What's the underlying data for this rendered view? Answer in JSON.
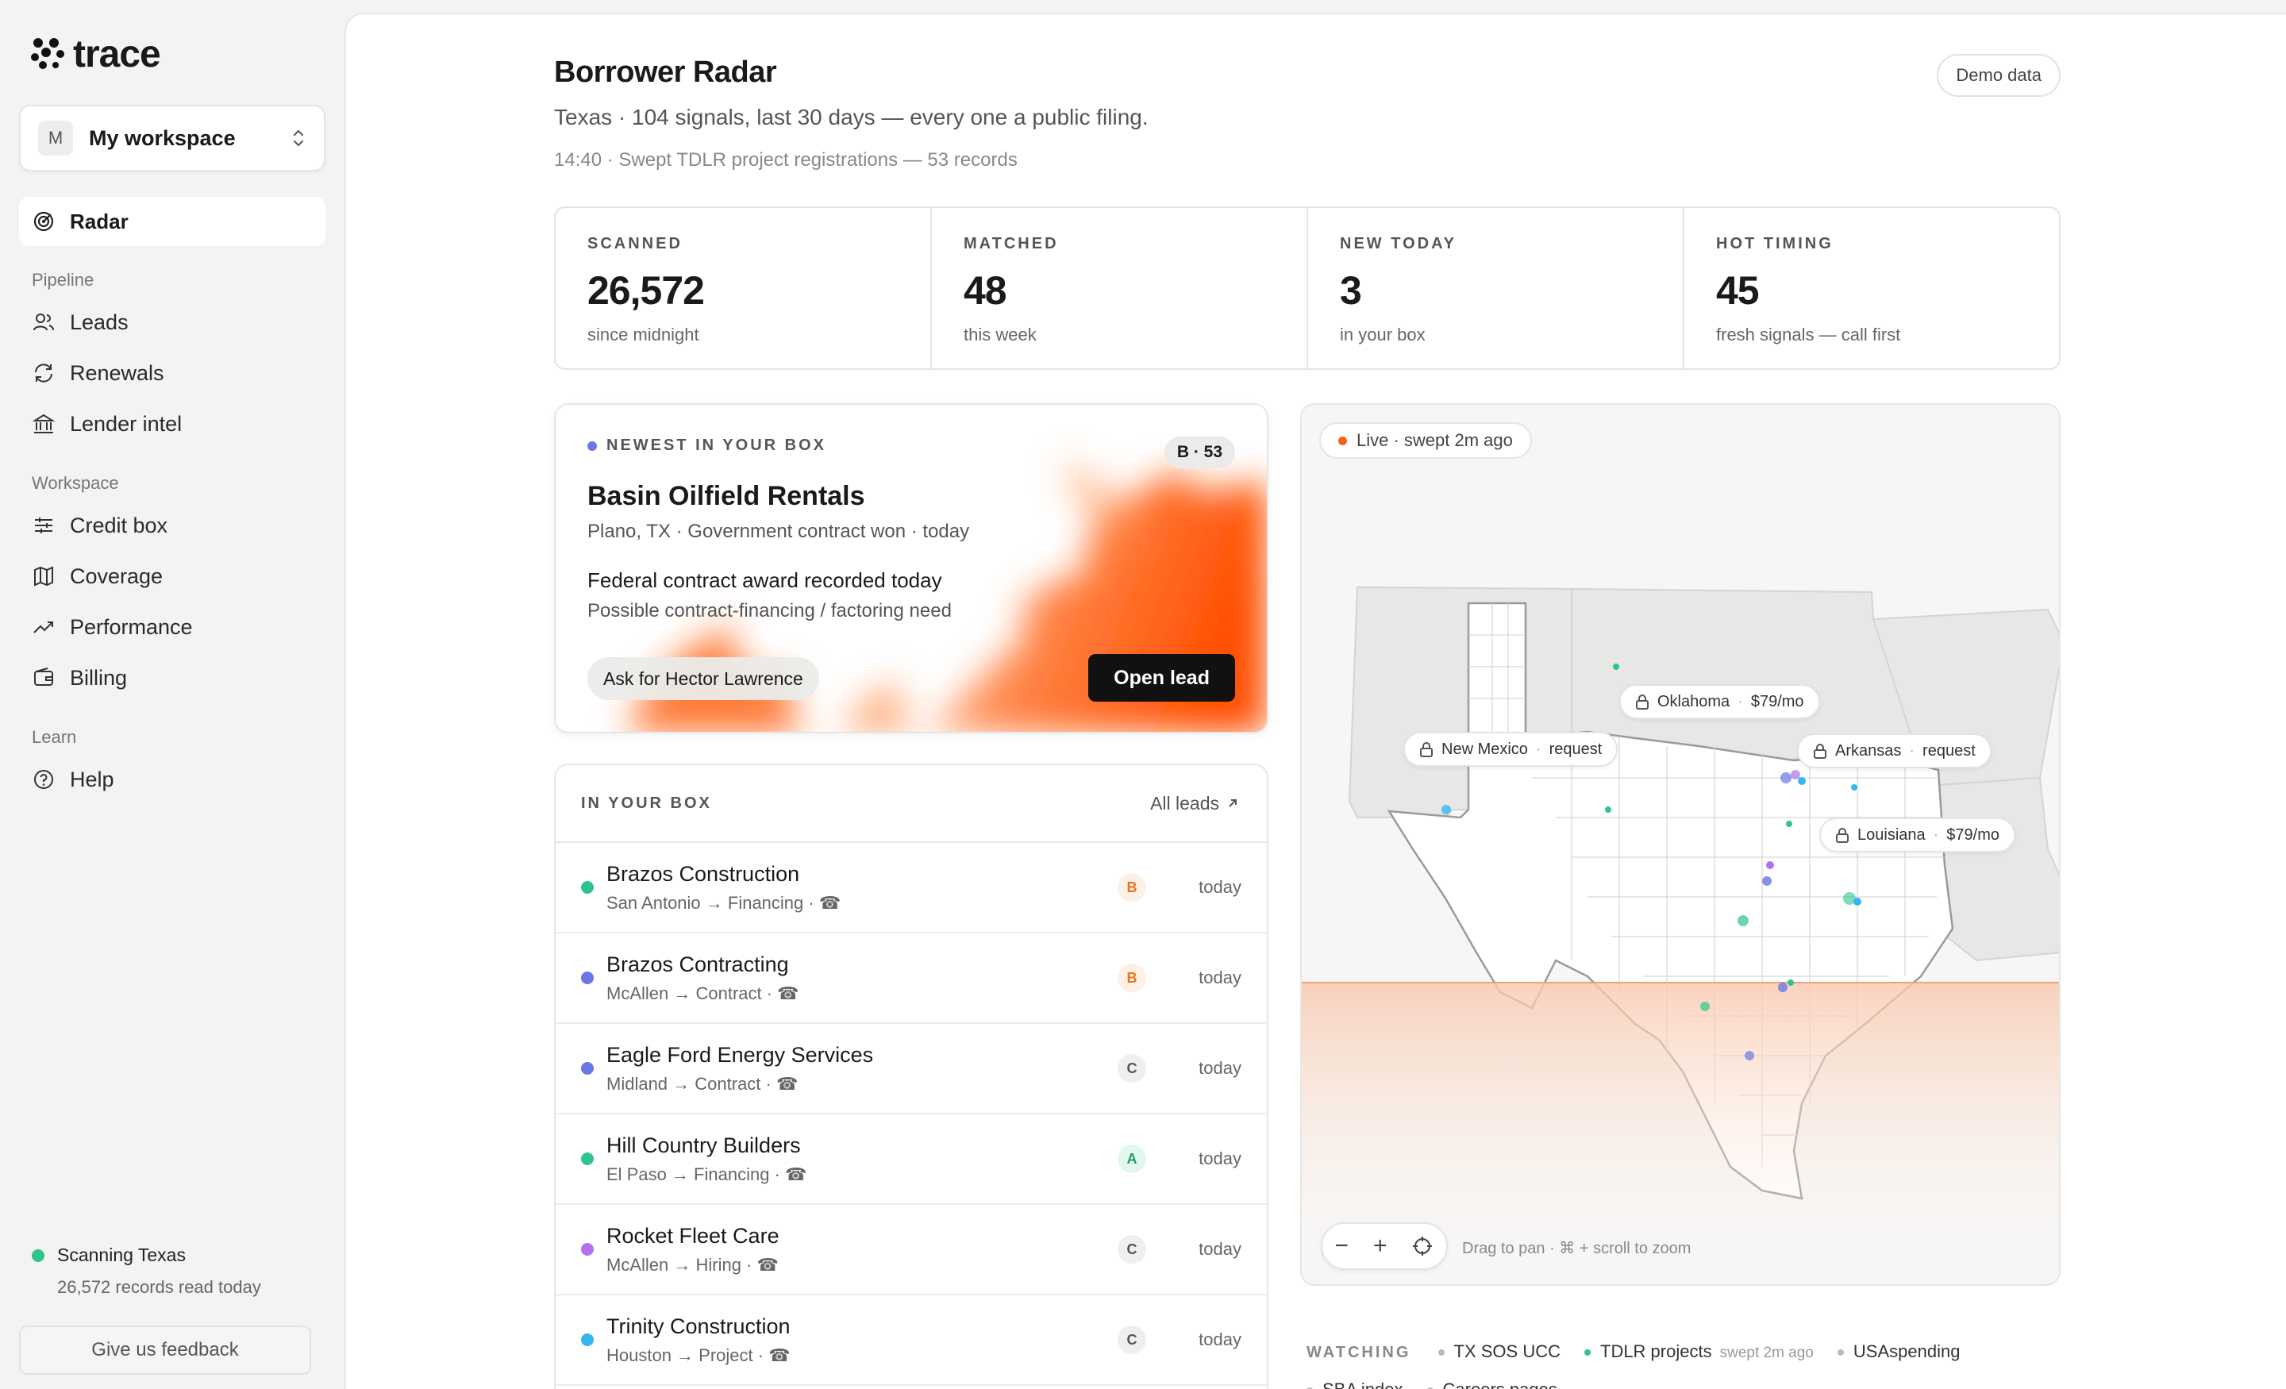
{
  "brand": {
    "name": "trace"
  },
  "workspace": {
    "initial": "M",
    "name": "My workspace"
  },
  "nav": {
    "active": "Radar",
    "groups": [
      {
        "label": "Pipeline",
        "items": [
          "Leads",
          "Renewals",
          "Lender intel"
        ]
      },
      {
        "label": "Workspace",
        "items": [
          "Credit box",
          "Coverage",
          "Performance",
          "Billing"
        ]
      },
      {
        "label": "Learn",
        "items": [
          "Help"
        ]
      }
    ]
  },
  "status": {
    "title": "Scanning Texas",
    "sub": "26,572 records read today"
  },
  "feedback_label": "Give us feedback",
  "page": {
    "title": "Borrower Radar",
    "subtitle": "Texas · 104 signals, last 30 days — every one a public filing.",
    "meta": "14:40 · Swept TDLR project registrations — 53 records",
    "demo_label": "Demo data"
  },
  "stats": [
    {
      "label": "SCANNED",
      "value": "26,572",
      "sub": "since midnight"
    },
    {
      "label": "MATCHED",
      "value": "48",
      "sub": "this week"
    },
    {
      "label": "NEW TODAY",
      "value": "3",
      "sub": "in your box"
    },
    {
      "label": "HOT TIMING",
      "value": "45",
      "sub": "fresh signals — call first"
    }
  ],
  "newest": {
    "label": "NEWEST IN YOUR BOX",
    "score": "B · 53",
    "name": "Basin Oilfield Rentals",
    "location": "Plano, TX · Government contract won · today",
    "headline": "Federal contract award recorded today",
    "need": "Possible contract-financing / factoring need",
    "ask": "Ask for Hector Lawrence",
    "open_label": "Open lead"
  },
  "inbox": {
    "title": "IN YOUR BOX",
    "all_label": "All leads",
    "rows": [
      {
        "name": "Brazos Construction",
        "sub": "San Antonio → Financing · ☎",
        "grade": "B",
        "when": "today",
        "dot": "#2fc48d"
      },
      {
        "name": "Brazos Contracting",
        "sub": "McAllen → Contract · ☎",
        "grade": "B",
        "when": "today",
        "dot": "#6b77e5"
      },
      {
        "name": "Eagle Ford Energy Services",
        "sub": "Midland → Contract · ☎",
        "grade": "C",
        "when": "today",
        "dot": "#6b77e5"
      },
      {
        "name": "Hill Country Builders",
        "sub": "El Paso → Financing · ☎",
        "grade": "A",
        "when": "today",
        "dot": "#2fc48d"
      },
      {
        "name": "Rocket Fleet Care",
        "sub": "McAllen → Hiring · ☎",
        "grade": "C",
        "when": "today",
        "dot": "#b46ff0"
      },
      {
        "name": "Trinity Construction",
        "sub": "Houston → Project · ☎",
        "grade": "C",
        "when": "today",
        "dot": "#35b6ee"
      }
    ]
  },
  "map": {
    "live_label": "Live · swept 2m ago",
    "states": [
      {
        "name": "Oklahoma",
        "price": "$79/mo"
      },
      {
        "name": "New Mexico",
        "price": "request"
      },
      {
        "name": "Arkansas",
        "price": "request"
      },
      {
        "name": "Louisiana",
        "price": "$79/mo"
      }
    ],
    "zoom_out": "−",
    "zoom_in": "+",
    "hint": "Drag to pan · ⌘ + scroll to zoom"
  },
  "watching": {
    "title": "WATCHING",
    "sources": [
      {
        "name": "TX SOS UCC",
        "note": ""
      },
      {
        "name": "TDLR projects",
        "note": "swept 2m ago"
      },
      {
        "name": "USAspending",
        "note": ""
      },
      {
        "name": "SBA index",
        "note": ""
      },
      {
        "name": "Careers pages",
        "note": ""
      }
    ]
  },
  "colors": {
    "accent": "#f3621d",
    "active_bg": "#ffffff",
    "sidebar_bg": "#f3f3f2"
  }
}
